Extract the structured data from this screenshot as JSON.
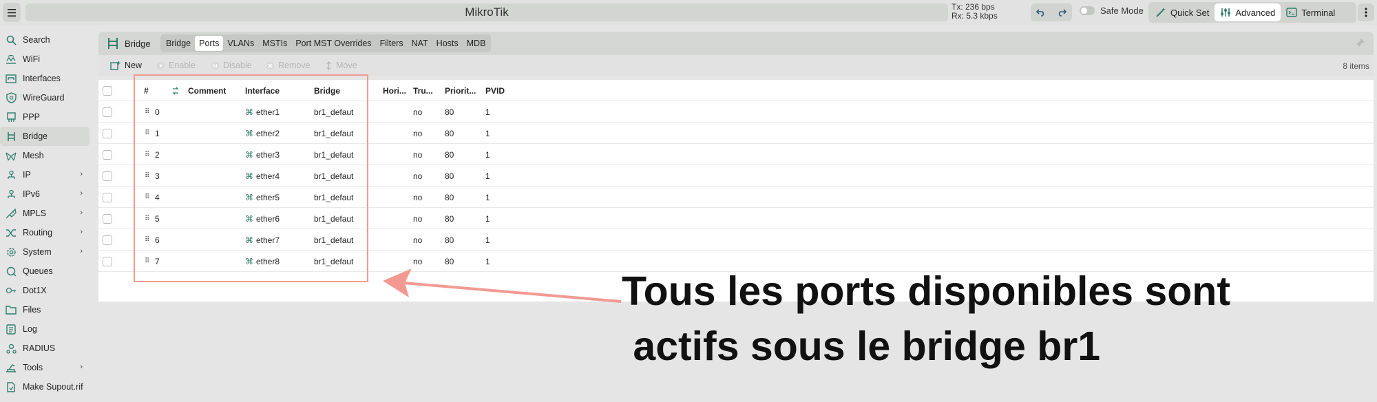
{
  "app": {
    "title": "MikroTik",
    "tx": "Tx: 236 bps",
    "rx": "Rx: 5.3 kbps",
    "safe_mode_label": "Safe Mode",
    "modes": [
      {
        "label": "Quick Set",
        "icon": "wand-icon",
        "active": false
      },
      {
        "label": "Advanced",
        "icon": "sliders-icon",
        "active": true
      },
      {
        "label": "Terminal",
        "icon": "terminal-icon",
        "active": false
      }
    ]
  },
  "sidebar": {
    "items": [
      {
        "label": "Search",
        "icon": "search-icon",
        "submenu": false
      },
      {
        "label": "WiFi",
        "icon": "wifi-icon",
        "submenu": false
      },
      {
        "label": "Interfaces",
        "icon": "interfaces-icon",
        "submenu": false
      },
      {
        "label": "WireGuard",
        "icon": "shield-icon",
        "submenu": false
      },
      {
        "label": "PPP",
        "icon": "ppp-icon",
        "submenu": false
      },
      {
        "label": "Bridge",
        "icon": "bridge-icon",
        "submenu": false,
        "active": true
      },
      {
        "label": "Mesh",
        "icon": "mesh-icon",
        "submenu": false
      },
      {
        "label": "IP",
        "icon": "ip-icon",
        "submenu": true
      },
      {
        "label": "IPv6",
        "icon": "ipv6-icon",
        "submenu": true
      },
      {
        "label": "MPLS",
        "icon": "mpls-icon",
        "submenu": true
      },
      {
        "label": "Routing",
        "icon": "routing-icon",
        "submenu": true
      },
      {
        "label": "System",
        "icon": "gear-icon",
        "submenu": true
      },
      {
        "label": "Queues",
        "icon": "queues-icon",
        "submenu": false
      },
      {
        "label": "Dot1X",
        "icon": "dot1x-icon",
        "submenu": false
      },
      {
        "label": "Files",
        "icon": "folder-icon",
        "submenu": false
      },
      {
        "label": "Log",
        "icon": "log-icon",
        "submenu": false
      },
      {
        "label": "RADIUS",
        "icon": "radius-icon",
        "submenu": false
      },
      {
        "label": "Tools",
        "icon": "tools-icon",
        "submenu": true
      },
      {
        "label": "Make Supout.rif",
        "icon": "supout-icon",
        "submenu": false
      }
    ]
  },
  "panel": {
    "section_title": "Bridge",
    "tabs": [
      {
        "label": "Bridge",
        "active": false
      },
      {
        "label": "Ports",
        "active": true
      },
      {
        "label": "VLANs",
        "active": false
      },
      {
        "label": "MSTIs",
        "active": false
      },
      {
        "label": "Port MST Overrides",
        "active": false
      },
      {
        "label": "Filters",
        "active": false
      },
      {
        "label": "NAT",
        "active": false
      },
      {
        "label": "Hosts",
        "active": false
      },
      {
        "label": "MDB",
        "active": false
      }
    ],
    "toolbar": {
      "new": "New",
      "enable": "Enable",
      "disable": "Disable",
      "remove": "Remove",
      "move": "Move",
      "count": "8 items"
    },
    "columns": {
      "num": "#",
      "comment": "Comment",
      "interface": "Interface",
      "bridge": "Bridge",
      "horizon": "Hori...",
      "trusted": "Tru...",
      "priority": "Priorit...",
      "pvid": "PVID"
    },
    "rows": [
      {
        "num": "0",
        "interface": "ether1",
        "bridge": "br1_defaut",
        "trusted": "no",
        "priority": "80",
        "pvid": "1"
      },
      {
        "num": "1",
        "interface": "ether2",
        "bridge": "br1_defaut",
        "trusted": "no",
        "priority": "80",
        "pvid": "1"
      },
      {
        "num": "2",
        "interface": "ether3",
        "bridge": "br1_defaut",
        "trusted": "no",
        "priority": "80",
        "pvid": "1"
      },
      {
        "num": "3",
        "interface": "ether4",
        "bridge": "br1_defaut",
        "trusted": "no",
        "priority": "80",
        "pvid": "1"
      },
      {
        "num": "4",
        "interface": "ether5",
        "bridge": "br1_defaut",
        "trusted": "no",
        "priority": "80",
        "pvid": "1"
      },
      {
        "num": "5",
        "interface": "ether6",
        "bridge": "br1_defaut",
        "trusted": "no",
        "priority": "80",
        "pvid": "1"
      },
      {
        "num": "6",
        "interface": "ether7",
        "bridge": "br1_defaut",
        "trusted": "no",
        "priority": "80",
        "pvid": "1"
      },
      {
        "num": "7",
        "interface": "ether8",
        "bridge": "br1_defaut",
        "trusted": "no",
        "priority": "80",
        "pvid": "1"
      }
    ]
  },
  "annotation": {
    "line1": "Tous les ports disponibles sont",
    "line2": " actifs sous le bridge br1",
    "color": "#f29a92"
  },
  "colors": {
    "accent": "#2f7d6b",
    "background": "#e4e5e4"
  }
}
